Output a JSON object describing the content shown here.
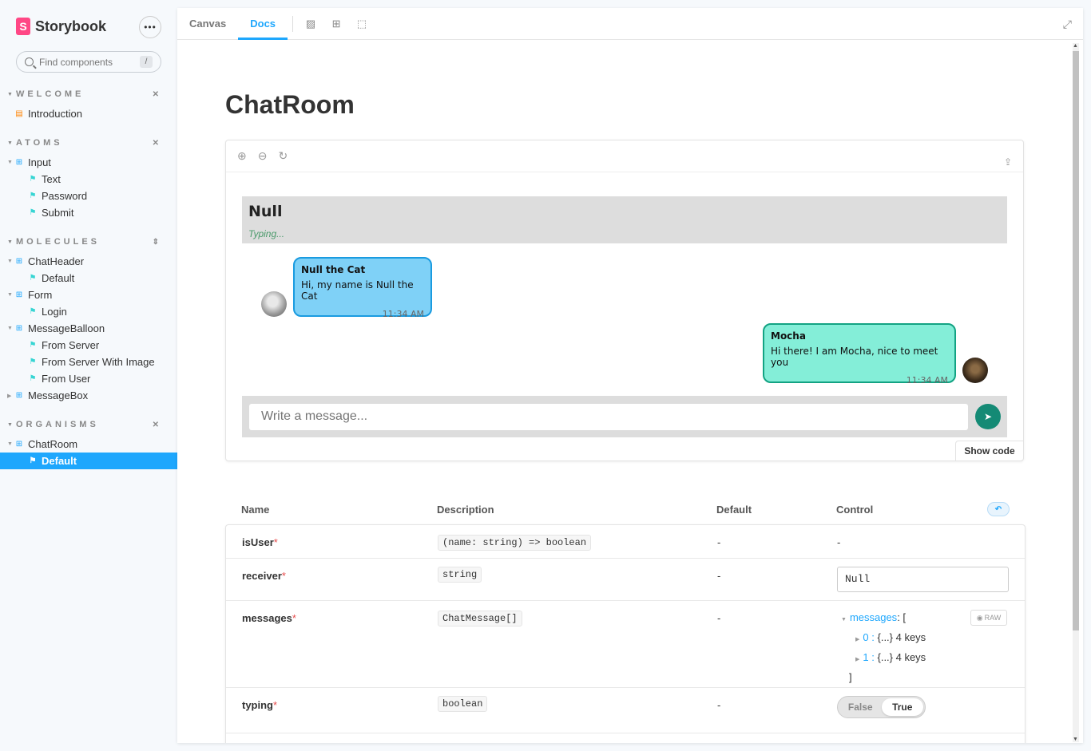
{
  "brand": {
    "name": "Storybook",
    "logo": "S"
  },
  "search": {
    "placeholder": "Find components",
    "shortcut": "/"
  },
  "sidebar": {
    "sections": [
      {
        "label": "WELCOME"
      },
      {
        "label": "ATOMS"
      },
      {
        "label": "MOLECULES"
      },
      {
        "label": "ORGANISMS"
      }
    ],
    "items": [
      {
        "label": "Introduction"
      },
      {
        "label": "Input"
      },
      {
        "label": "Text"
      },
      {
        "label": "Password"
      },
      {
        "label": "Submit"
      },
      {
        "label": "ChatHeader"
      },
      {
        "label": "Default"
      },
      {
        "label": "Form"
      },
      {
        "label": "Login"
      },
      {
        "label": "MessageBalloon"
      },
      {
        "label": "From Server"
      },
      {
        "label": "From Server With Image"
      },
      {
        "label": "From User"
      },
      {
        "label": "MessageBox"
      },
      {
        "label": "ChatRoom"
      },
      {
        "label": "Default"
      }
    ]
  },
  "tabs": {
    "canvas": "Canvas",
    "docs": "Docs"
  },
  "page": {
    "title": "ChatRoom"
  },
  "chat": {
    "receiver": "Null",
    "typing": "Typing...",
    "messages": [
      {
        "sender": "Null the Cat",
        "text": "Hi, my name is Null the Cat",
        "time": "11:34 AM"
      },
      {
        "sender": "Mocha",
        "text": "Hi there! I am Mocha, nice to meet you",
        "time": "11:34 AM"
      }
    ],
    "composer_placeholder": "Write a message..."
  },
  "show_code": "Show code",
  "props_table": {
    "headers": {
      "name": "Name",
      "description": "Description",
      "default": "Default",
      "control": "Control"
    },
    "rows": [
      {
        "name": "isUser",
        "type": "(name: string) => boolean",
        "default": "-",
        "control": "-"
      },
      {
        "name": "receiver",
        "type": "string",
        "default": "-",
        "control": "Null"
      },
      {
        "name": "messages",
        "type": "ChatMessage[]",
        "default": "-",
        "tree_key": "messages",
        "tree_open": ":  [",
        "item0": "0 :",
        "item1": "1 :",
        "item_val": "{...} 4 keys",
        "tree_close": "]",
        "raw": "RAW"
      },
      {
        "name": "typing",
        "type": "boolean",
        "default": "-",
        "toggle_false": "False",
        "toggle_true": "True"
      }
    ],
    "required_mark": "*"
  },
  "colors": {
    "accent": "#1ea7fd",
    "brand": "#ff4785",
    "server_bubble": "#7fd1f7",
    "user_bubble": "#84eed8",
    "send": "#148a75"
  }
}
